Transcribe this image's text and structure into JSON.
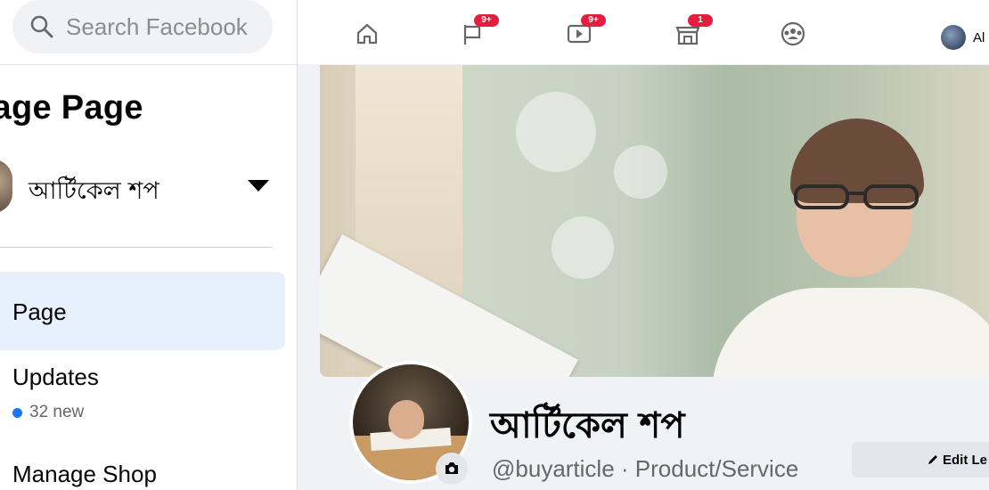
{
  "search": {
    "placeholder": "Search Facebook"
  },
  "sidebar": {
    "title": "nage Page",
    "page_selector": {
      "name": "আর্টিকেল শপ"
    },
    "items": [
      {
        "label": "Page"
      },
      {
        "label": "Updates",
        "sub": "32 new"
      },
      {
        "label": "Manage Shop"
      }
    ]
  },
  "topnav": {
    "home": {
      "icon": "home-icon"
    },
    "pages": {
      "icon": "flag-icon",
      "badge": "9+"
    },
    "watch": {
      "icon": "video-icon",
      "badge": "9+"
    },
    "marketplace": {
      "icon": "store-icon",
      "badge": "1"
    },
    "groups": {
      "icon": "groups-icon"
    },
    "profile": {
      "name": "Al"
    }
  },
  "profile": {
    "name": "আর্টিকেল শপ",
    "handle": "@buyarticle · Product/Service",
    "edit_button": "Edit Le"
  },
  "colors": {
    "accent": "#1877f2",
    "selected_bg": "#e7f0fd",
    "badge": "#e41e3f"
  }
}
